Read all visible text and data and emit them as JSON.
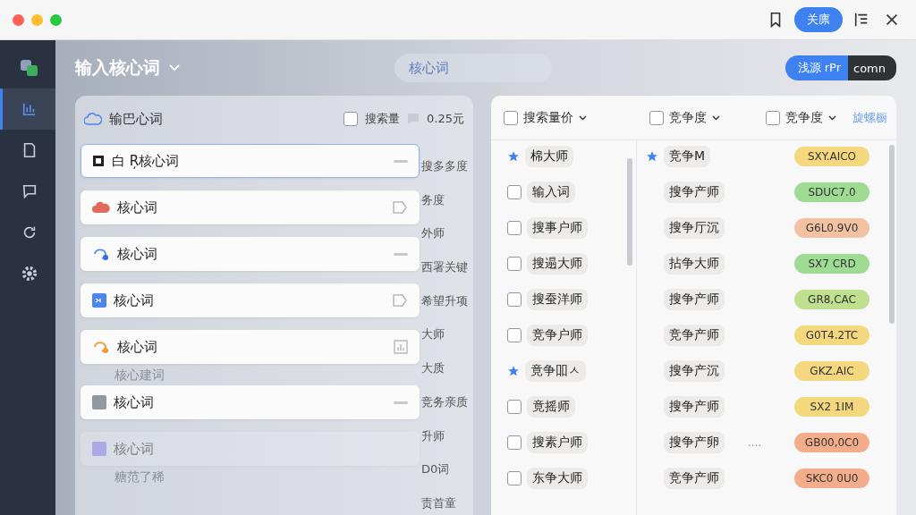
{
  "title_bar": {
    "primary_button": "关廪"
  },
  "sidebar": {
    "items": [
      {
        "selected": false
      },
      {
        "selected": true
      },
      {
        "selected": false
      },
      {
        "selected": false
      },
      {
        "selected": false
      },
      {
        "selected": false
      }
    ]
  },
  "header": {
    "title": "输入核心词",
    "search": {
      "placeholder": "核心词"
    },
    "button": "浅源 rPr",
    "tag": "comn"
  },
  "left_panel": {
    "title": "输巴心词",
    "checkbox": {
      "label": "搜索量",
      "checked": false
    },
    "price": "0.25元",
    "side_texts": [
      "搜多多度",
      "务度",
      "外师",
      "西署关键",
      "希望升项",
      "大师",
      "大质",
      "竞务亲质",
      "升师",
      "D0词",
      "责首童"
    ],
    "items": [
      {
        "kind": "card",
        "text": "白 Ŗ核心词",
        "selected": true
      },
      {
        "kind": "card",
        "text": "核心词",
        "selected": false
      },
      {
        "kind": "card",
        "text": "核心词",
        "selected": false
      },
      {
        "kind": "card",
        "text": "核心词",
        "selected": false
      },
      {
        "kind": "card",
        "text": "核心词",
        "selected": false
      },
      {
        "kind": "ghost",
        "text": "核心建词"
      },
      {
        "kind": "card",
        "text": "核心词",
        "selected": false
      },
      {
        "kind": "faded",
        "text": "核心词",
        "selected": false
      },
      {
        "kind": "ghost",
        "text": "糖范了稀"
      }
    ]
  },
  "right_panel": {
    "columns": [
      {
        "label": "搜索量价",
        "kind": "checkbox",
        "checked": false
      },
      {
        "label": "竞争度",
        "kind": "checkbox",
        "checked": false
      },
      {
        "label": "竞争度",
        "kind": "checkbox",
        "checked": false
      },
      {
        "label": "旋螺橱",
        "kind": "link"
      }
    ],
    "left_rows": [
      {
        "text": "棉大师",
        "starred": true
      },
      {
        "text": "输入词",
        "starred": false
      },
      {
        "text": "搜事户师",
        "starred": false
      },
      {
        "text": "搜遢大师",
        "starred": false
      },
      {
        "text": "搜蚕洋师",
        "starred": false
      },
      {
        "text": "竞争户师",
        "starred": false
      },
      {
        "text": "竟争吅ㅅ",
        "starred": true
      },
      {
        "text": "竟摇师",
        "starred": false
      },
      {
        "text": "搜素户师",
        "starred": false
      },
      {
        "text": "东争大师",
        "starred": false
      }
    ],
    "right_rows": [
      {
        "text": "竞争M",
        "starred": true,
        "badge": "SXY.AICO",
        "color": "#f5d77e"
      },
      {
        "text": "搜争产师",
        "starred": false,
        "badge": "SDUC7.0",
        "color": "#9edc93"
      },
      {
        "text": "搜争厅沉",
        "starred": false,
        "badge": "G6L0.9V0",
        "color": "#f3c2a3"
      },
      {
        "text": "拈争大师",
        "starred": false,
        "badge": "SX7 CRD",
        "color": "#9edc93"
      },
      {
        "text": "搜争产师",
        "starred": false,
        "badge": "GR8,CAC",
        "color": "#bfe08f"
      },
      {
        "text": "竞争产师",
        "starred": false,
        "badge": "G0T4.2TC",
        "color": "#f5d77e"
      },
      {
        "text": "搜争产沉",
        "starred": false,
        "badge": "GKZ.AIC",
        "color": "#f5d77e"
      },
      {
        "text": "搜争产师",
        "starred": false,
        "badge": "SX2 1IM",
        "color": "#f5d77e"
      },
      {
        "text": "搜争产卵",
        "starred": false,
        "badge": "GB00,0C0",
        "color": "#f4ad8a",
        "more": "...."
      },
      {
        "text": "竞争产师",
        "starred": false,
        "badge": "SKC0 0U0",
        "color": "#f4ad8a"
      }
    ]
  }
}
